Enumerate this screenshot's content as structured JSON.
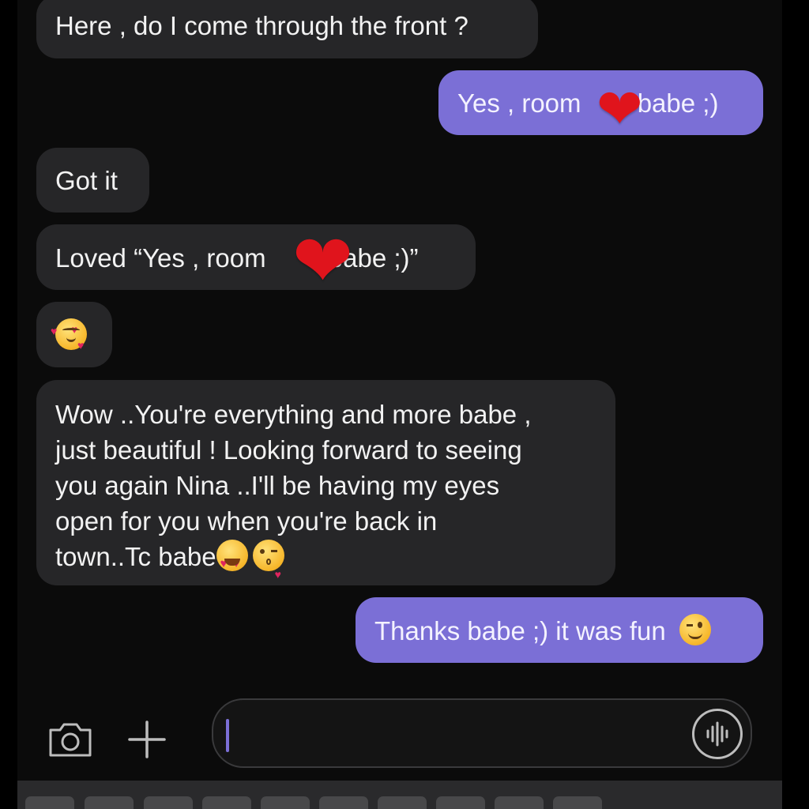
{
  "messages": [
    {
      "dir": "in",
      "text": "Here , do I come through the front ?"
    },
    {
      "dir": "out",
      "text": "Yes , room 210 babe ;)"
    },
    {
      "dir": "in",
      "text": "Got it"
    },
    {
      "dir": "in",
      "text": "Loved “Yes , room 210 babe ;)”"
    },
    {
      "dir": "in",
      "emoji": "smiling-face-with-hearts"
    },
    {
      "dir": "in",
      "lines": [
        "Wow ..You're everything and more babe ,",
        "just beautiful ! Looking forward to seeing",
        "you again Nina ..I'll be having my eyes",
        "open for you when you're back in",
        "town..Tc babe"
      ],
      "trailing_emojis": [
        "heart-eyes",
        "face-blowing-kiss"
      ]
    },
    {
      "dir": "out",
      "text": "Thanks babe ;) it was fun",
      "trailing_emoji": "winking-face"
    }
  ],
  "msg": {
    "m1": "Here , do I come through the front ?",
    "m2_a": "Yes , room ",
    "m2_b": "babe ;)",
    "m3": "Got it",
    "m4_a": "Loved “Yes , room ",
    "m4_b": "babe ;)”",
    "m6_l1": "Wow ..You're everything and more babe ,",
    "m6_l2": "just beautiful ! Looking forward to seeing",
    "m6_l3": "you again Nina ..I'll be having my eyes",
    "m6_l4": "open for you when you're back in",
    "m6_l5": "town..Tc babe",
    "m7": "Thanks babe ;) it was fun"
  },
  "overlays": {
    "sticker": "red-heart-sticker"
  },
  "composer": {
    "camera_icon": "camera-icon",
    "plus_icon": "plus-icon",
    "voice_icon": "voice-waveform-icon"
  },
  "colors": {
    "incoming_bubble": "#262628",
    "outgoing_bubble": "#7b6fd6",
    "background": "#0b0b0b",
    "heart": "#e0141c"
  }
}
